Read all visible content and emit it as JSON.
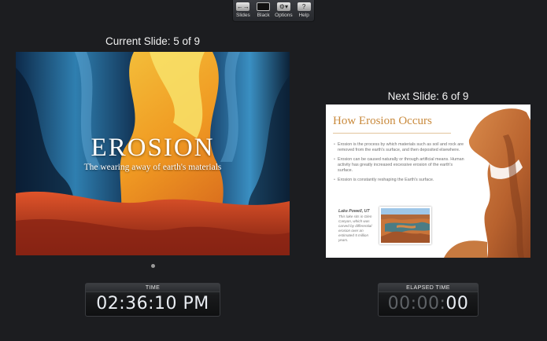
{
  "toolbar": {
    "items": [
      {
        "label": "Slides",
        "icon": "slides-icon",
        "glyph": "←→"
      },
      {
        "label": "Black",
        "icon": "black-screen-icon",
        "glyph": ""
      },
      {
        "label": "Options",
        "icon": "gear-icon",
        "glyph": "⚙▾"
      },
      {
        "label": "Help",
        "icon": "help-icon",
        "glyph": "?"
      }
    ]
  },
  "current": {
    "caption": "Current Slide: 5 of 9",
    "title": "EROSION",
    "subtitle": "The wearing away of earth's materials"
  },
  "next": {
    "caption": "Next Slide: 6 of 9",
    "title": "How Erosion Occurs",
    "bullets": [
      "Erosion is the process by which materials such as soil and rock are removed from the earth's surface, and then deposited elsewhere.",
      "Erosion can be caused naturally or through artificial means. Human activity has greatly increased excessive erosion of the earth's surface.",
      "Erosion is constantly reshaping the Earth's surface."
    ],
    "photo_title": "Lake Powell, UT",
    "photo_caption": "This lake sits in Glen Canyon, which was carved by differential erosion over an estimated 5 million years."
  },
  "clocks": {
    "time_label": "TIME",
    "time_value": "02:36:10 PM",
    "elapsed_label": "ELAPSED TIME",
    "elapsed_dim": "00:00:",
    "elapsed_bright": "00"
  },
  "colors": {
    "background": "#1c1d20",
    "next_title": "#c98a3c"
  }
}
